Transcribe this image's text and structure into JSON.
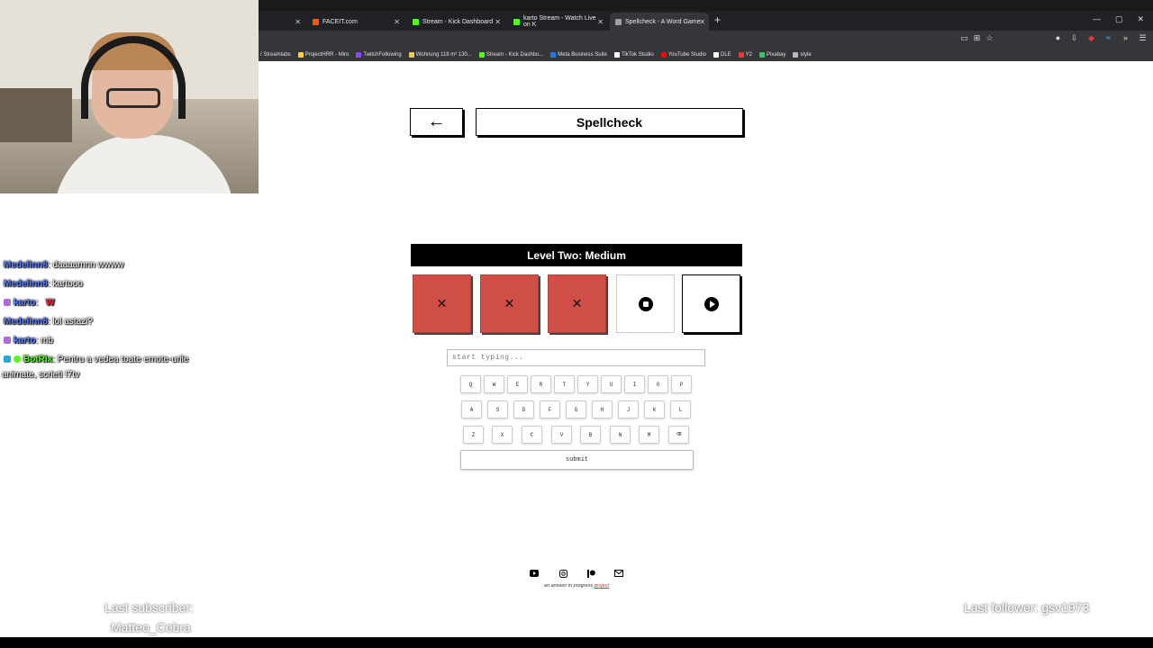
{
  "browser": {
    "tabs": [
      {
        "label": "",
        "color": "#888888"
      },
      {
        "label": "FACEIT.com",
        "color": "#ff5500"
      },
      {
        "label": "Stream - Kick Dashboard",
        "color": "#53fc18"
      },
      {
        "label": "karto Stream - Watch Live on K",
        "color": "#53fc18"
      },
      {
        "label": "Spellcheck - A Word Game",
        "color": "#9aa0a6"
      }
    ],
    "new_tab": "+",
    "window_controls": [
      "—",
      "▢",
      "✕"
    ],
    "bookmarks": [
      {
        "label": "/ Streamlabs",
        "color": "#80f5d2"
      },
      {
        "label": "ProjectHRR - Miro",
        "color": "#ffd02f"
      },
      {
        "label": "TwitchFollowing",
        "color": "#9146ff"
      },
      {
        "label": "Wohnung 118 m² 130...",
        "color": "#f2c94c"
      },
      {
        "label": "Stream - Kick Dashbo...",
        "color": "#53fc18"
      },
      {
        "label": "Meta Business Suite",
        "color": "#1877f2"
      },
      {
        "label": "TikTok Studio",
        "color": "#ffffff"
      },
      {
        "label": "YouTube Studio",
        "color": "#ff0000"
      },
      {
        "label": "DLE",
        "color": "#ffffff"
      },
      {
        "label": "Y2",
        "color": "#e53935"
      },
      {
        "label": "Pixabay",
        "color": "#2ec66d"
      },
      {
        "label": "style",
        "color": "#bbbbbb"
      }
    ]
  },
  "game": {
    "back_label": "←",
    "title": "Spellcheck",
    "level_label": "Level Two: Medium",
    "attempts": [
      {
        "state": "fail",
        "glyph": "✕"
      },
      {
        "state": "fail",
        "glyph": "✕"
      },
      {
        "state": "fail",
        "glyph": "✕"
      },
      {
        "state": "pending",
        "glyph": "stop"
      },
      {
        "state": "play",
        "glyph": "play"
      }
    ],
    "input_placeholder": "start typing...",
    "keyboard": {
      "row1": [
        "Q",
        "W",
        "E",
        "R",
        "T",
        "Y",
        "U",
        "I",
        "O",
        "P"
      ],
      "row2": [
        "A",
        "S",
        "D",
        "F",
        "G",
        "H",
        "J",
        "K",
        "L"
      ],
      "row3": [
        "Z",
        "X",
        "C",
        "V",
        "B",
        "N",
        "M"
      ],
      "backspace": "⌫"
    },
    "submit_label": "submit"
  },
  "footer": {
    "icons": [
      "youtube-icon",
      "instagram-icon",
      "patreon-icon",
      "email-icon"
    ],
    "text": "an answer in progress ",
    "link": "project"
  },
  "chat": [
    {
      "user": "Medelinn8",
      "user_color": "#5b7fff",
      "message": ": daaaamnn wwww",
      "badge": null
    },
    {
      "user": "Medelinn8",
      "user_color": "#5b7fff",
      "message": ": kartooo",
      "badge": null
    },
    {
      "user": "karto",
      "user_color": "#5b7fff",
      "message": ":",
      "emote": "W",
      "badge": "#b06bd6"
    },
    {
      "user": "Medelinn8",
      "user_color": "#5b7fff",
      "message": ": lol astazi?",
      "badge": null
    },
    {
      "user": "karto",
      "user_color": "#5b7fff",
      "message": ": mb",
      "badge": "#b06bd6"
    },
    {
      "user": "BotRix",
      "user_color": "#53fc18",
      "message": ": Pentru a vedea toate emote-urile",
      "badge": "#2aa7d8",
      "continuation": "animate, scrieti !7tv"
    }
  ],
  "overlays": {
    "last_subscriber_label": "Last subscriber:",
    "last_subscriber_name": "Matteo_Cobra",
    "last_follower": "Last follower: gsv1973"
  }
}
